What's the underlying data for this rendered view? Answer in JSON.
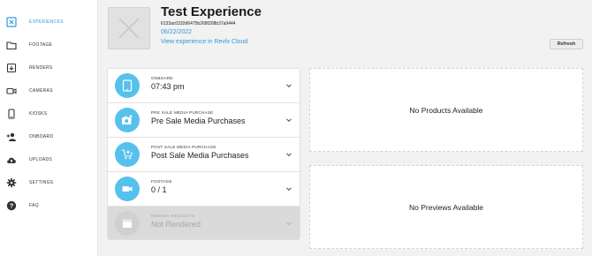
{
  "sidebar": {
    "items": [
      {
        "label": "EXPERIENCES",
        "icon": "experiences-icon",
        "active": true
      },
      {
        "label": "FOOTAGE",
        "icon": "folder-icon",
        "active": false
      },
      {
        "label": "RENDERS",
        "icon": "renders-icon",
        "active": false
      },
      {
        "label": "CAMERAS",
        "icon": "camera-icon",
        "active": false
      },
      {
        "label": "KIOSKS",
        "icon": "kiosk-icon",
        "active": false
      },
      {
        "label": "ONBOARD",
        "icon": "add-person-icon",
        "active": false
      },
      {
        "label": "UPLOADS",
        "icon": "cloud-upload-icon",
        "active": false
      },
      {
        "label": "SETTINGS",
        "icon": "gear-icon",
        "active": false
      },
      {
        "label": "FAQ",
        "icon": "help-icon",
        "active": false
      }
    ]
  },
  "header": {
    "title": "Test Experience",
    "id": "6133ac0332d6475b268f208b37a9444",
    "date": "06/22/2022",
    "link": "View experience in Revlx Cloud",
    "refresh_label": "Refresh"
  },
  "steps": [
    {
      "caption": "ONBOARD",
      "value": "07:43 pm",
      "icon": "tablet-icon",
      "enabled": true
    },
    {
      "caption": "PRE SALE MEDIA PURCHASE",
      "value": "Pre Sale Media Purchases",
      "icon": "add-photo-icon",
      "enabled": true
    },
    {
      "caption": "POST SALE MEDIA PURCHASE",
      "value": "Post Sale Media Purchases",
      "icon": "add-cart-icon",
      "enabled": true
    },
    {
      "caption": "FOOTAGE",
      "value": "0 / 1",
      "icon": "video-camera-icon",
      "enabled": true
    },
    {
      "caption": "RENDER REQUESTS",
      "value": "Not Rendered",
      "icon": "clapperboard-icon",
      "enabled": false
    }
  ],
  "products_panel": {
    "text": "No Products Available"
  },
  "previews_panel": {
    "text": "No Previews Available"
  },
  "colors": {
    "accent": "#2f9ad5",
    "step_circle": "#56c1ec",
    "disabled_row": "#dadada",
    "background": "#f2f2f2"
  }
}
